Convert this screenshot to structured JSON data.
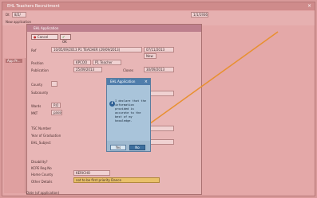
{
  "app": {
    "title": "EHL Teachers Recruitment",
    "close_glyph": "×"
  },
  "left_panel": {
    "header": "App Pr..."
  },
  "outer_form": {
    "lbl_1": "Dt",
    "val_1": "8/2/",
    "lbl_2": "App",
    "lbl_3": "Now application",
    "right_field": "1/1/1936"
  },
  "inner_window": {
    "title": "EHL Application",
    "cancel_label": "Cancel",
    "ok_label": "OK",
    "fields": {
      "ref_label": "Ref",
      "ref_value": "10/05/09/2013 P1 TEACHER (29/09/2013)",
      "ref_date": "07/11/2013",
      "ref_small": "New",
      "position_label": "Position",
      "position_code": "KPCOO",
      "position_name": "P1 Teacher",
      "publication_label": "Publication",
      "publication_date": "25/09/2013",
      "closes_label": "Closes",
      "closes_date": "30/09/2013",
      "county_label": "County",
      "subcounty_label": "Subcounty",
      "wards_label": "Wards",
      "wards_val": "P.O",
      "mkt_label": "MKT",
      "mkt_val": "passed",
      "tsc_label": "TSC Number",
      "year_label": "Year of Graduation",
      "ehl_label": "EHL_Subject",
      "disability_label": "Disability?",
      "kcpe_label": "KCPE Reg No",
      "home_county_label": "Home County",
      "home_county_val": "KERICHO",
      "other_label": "Other Details",
      "other_val": "not to be first priority Dance",
      "bottom_label": "Date (of application)"
    }
  },
  "dialog": {
    "title": "EHL Application",
    "close_glyph": "×",
    "icon_glyph": "i",
    "message": "I declare that the information provided is accurate to the best of my knowledge.",
    "yes_label": "Yes",
    "no_label": "No"
  },
  "colors": {
    "overlay": "#d99a9a",
    "dialog_title": "#4f7dab",
    "arrow": "#e89030",
    "highlight": "#e9c06a"
  }
}
